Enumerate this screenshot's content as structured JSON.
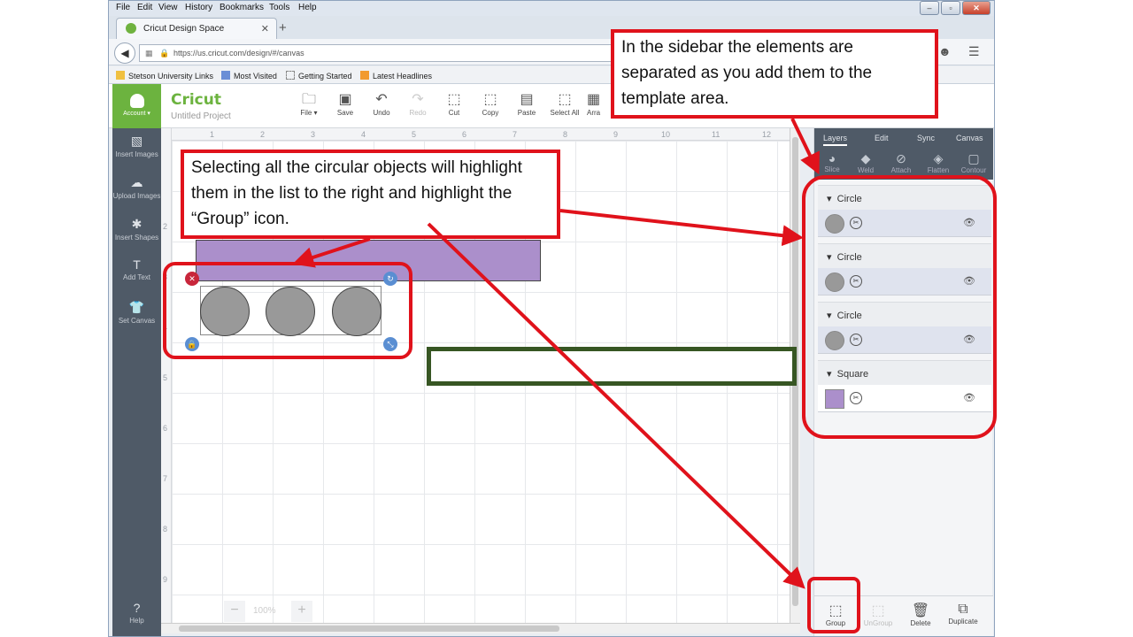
{
  "browser": {
    "menu": [
      "File",
      "Edit",
      "View",
      "History",
      "Bookmarks",
      "Tools",
      "Help"
    ],
    "tab_title": "Cricut Design Space",
    "url": "https://us.cricut.com/design/#/canvas",
    "bookmarks": [
      "Stetson University Links",
      "Most Visited",
      "Getting Started",
      "Latest Headlines"
    ]
  },
  "app": {
    "account_label": "Account ▾",
    "logo": "Cricut",
    "project_name": "Untitled Project",
    "toolbar": [
      {
        "label": "File ▾",
        "icon": "folder-icon",
        "glyph": "🗀"
      },
      {
        "label": "Save",
        "icon": "save-icon",
        "glyph": "▣"
      },
      {
        "label": "Undo",
        "icon": "undo-icon",
        "glyph": "↶"
      },
      {
        "label": "Redo",
        "icon": "redo-icon",
        "glyph": "↷"
      },
      {
        "label": "Cut",
        "icon": "cut-icon",
        "glyph": "⬚"
      },
      {
        "label": "Copy",
        "icon": "copy-icon",
        "glyph": "⬚"
      },
      {
        "label": "Paste",
        "icon": "paste-icon",
        "glyph": "▤"
      },
      {
        "label": "Select All",
        "icon": "select-all-icon",
        "glyph": "⬚"
      },
      {
        "label": "Arra",
        "icon": "arrange-icon",
        "glyph": "▦"
      }
    ],
    "left_sidebar": [
      {
        "label": "Insert Images",
        "icon": "image-icon",
        "glyph": "▧"
      },
      {
        "label": "Upload Images",
        "icon": "upload-icon",
        "glyph": "☁"
      },
      {
        "label": "Insert Shapes",
        "icon": "shapes-icon",
        "glyph": "✱"
      },
      {
        "label": "Add Text",
        "icon": "text-icon",
        "glyph": "T"
      },
      {
        "label": "Set Canvas",
        "icon": "shirt-icon",
        "glyph": "👕"
      }
    ],
    "help_label": "Help",
    "ruler_top": [
      "1",
      "2",
      "3",
      "4",
      "5",
      "6",
      "7",
      "8",
      "9",
      "10",
      "11",
      "12"
    ],
    "ruler_left": [
      "2",
      "3",
      "4",
      "5",
      "6",
      "7",
      "8",
      "9"
    ],
    "zoom": "100%"
  },
  "right_panel": {
    "tabs": [
      "Layers",
      "Edit",
      "Sync",
      "Canvas"
    ],
    "actions": [
      "Slice",
      "Weld",
      "Attach",
      "Flatten",
      "Contour"
    ],
    "layers": [
      {
        "name": "Circle",
        "color": "#999999"
      },
      {
        "name": "Circle",
        "color": "#999999"
      },
      {
        "name": "Circle",
        "color": "#999999"
      },
      {
        "name": "Square",
        "color": "#ab8fcb"
      }
    ],
    "bottom": [
      {
        "label": "Group",
        "icon": "group-icon",
        "glyph": "⬚"
      },
      {
        "label": "UnGroup",
        "icon": "ungroup-icon",
        "glyph": "⬚"
      },
      {
        "label": "Delete",
        "icon": "trash-icon",
        "glyph": "🗑"
      },
      {
        "label": "Duplicate",
        "icon": "duplicate-icon",
        "glyph": "⧉"
      }
    ]
  },
  "callouts": {
    "sidebar_note": "In the sidebar the elements are separated as you add them to the template area.",
    "select_note": "Selecting all the circular objects will highlight them in the list to the right and highlight the “Group” icon."
  },
  "colors": {
    "accent_green": "#6cb33f",
    "callout_red": "#e0121b",
    "dark_green": "#375623",
    "sidebar": "#4f5a67"
  }
}
